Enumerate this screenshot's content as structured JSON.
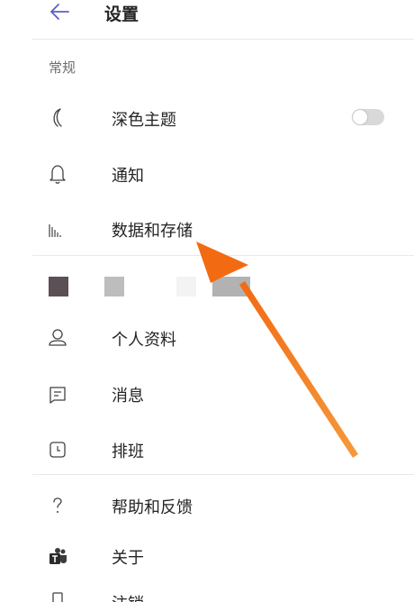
{
  "header": {
    "title": "设置",
    "back_icon": "arrow-left-icon"
  },
  "sections": {
    "general_label": "常规"
  },
  "general_items": [
    {
      "label": "深色主题",
      "icon": "moon-icon"
    },
    {
      "label": "通知",
      "icon": "bell-icon"
    },
    {
      "label": "数据和存储",
      "icon": "bar-chart-icon"
    }
  ],
  "dark_theme_toggle": {
    "on": false
  },
  "account_items": [
    {
      "label": "个人资料",
      "icon": "person-icon"
    },
    {
      "label": "消息",
      "icon": "message-icon"
    },
    {
      "label": "排班",
      "icon": "clock-icon"
    }
  ],
  "other_items": [
    {
      "label": "帮助和反馈",
      "icon": "question-icon"
    },
    {
      "label": "关于",
      "icon": "teams-icon"
    },
    {
      "label": "注销",
      "icon": "signout-icon"
    }
  ],
  "colors": {
    "accent_arrow": "#f0801e",
    "divider": "#e9e9e9",
    "text": "#242424",
    "muted": "#6e6e6e"
  }
}
